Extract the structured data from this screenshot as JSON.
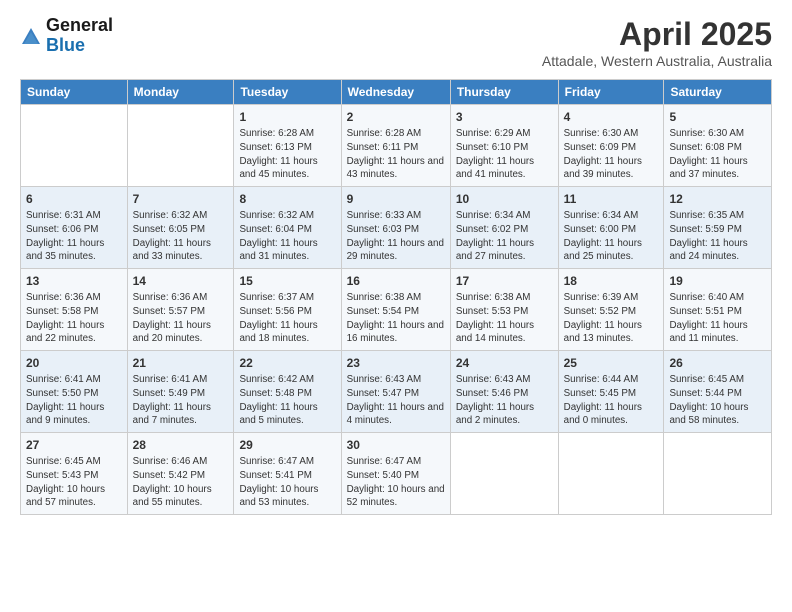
{
  "header": {
    "logo_line1": "General",
    "logo_line2": "Blue",
    "month_title": "April 2025",
    "location": "Attadale, Western Australia, Australia"
  },
  "weekdays": [
    "Sunday",
    "Monday",
    "Tuesday",
    "Wednesday",
    "Thursday",
    "Friday",
    "Saturday"
  ],
  "weeks": [
    [
      {
        "day": "",
        "sunrise": "",
        "sunset": "",
        "daylight": ""
      },
      {
        "day": "",
        "sunrise": "",
        "sunset": "",
        "daylight": ""
      },
      {
        "day": "1",
        "sunrise": "Sunrise: 6:28 AM",
        "sunset": "Sunset: 6:13 PM",
        "daylight": "Daylight: 11 hours and 45 minutes."
      },
      {
        "day": "2",
        "sunrise": "Sunrise: 6:28 AM",
        "sunset": "Sunset: 6:11 PM",
        "daylight": "Daylight: 11 hours and 43 minutes."
      },
      {
        "day": "3",
        "sunrise": "Sunrise: 6:29 AM",
        "sunset": "Sunset: 6:10 PM",
        "daylight": "Daylight: 11 hours and 41 minutes."
      },
      {
        "day": "4",
        "sunrise": "Sunrise: 6:30 AM",
        "sunset": "Sunset: 6:09 PM",
        "daylight": "Daylight: 11 hours and 39 minutes."
      },
      {
        "day": "5",
        "sunrise": "Sunrise: 6:30 AM",
        "sunset": "Sunset: 6:08 PM",
        "daylight": "Daylight: 11 hours and 37 minutes."
      }
    ],
    [
      {
        "day": "6",
        "sunrise": "Sunrise: 6:31 AM",
        "sunset": "Sunset: 6:06 PM",
        "daylight": "Daylight: 11 hours and 35 minutes."
      },
      {
        "day": "7",
        "sunrise": "Sunrise: 6:32 AM",
        "sunset": "Sunset: 6:05 PM",
        "daylight": "Daylight: 11 hours and 33 minutes."
      },
      {
        "day": "8",
        "sunrise": "Sunrise: 6:32 AM",
        "sunset": "Sunset: 6:04 PM",
        "daylight": "Daylight: 11 hours and 31 minutes."
      },
      {
        "day": "9",
        "sunrise": "Sunrise: 6:33 AM",
        "sunset": "Sunset: 6:03 PM",
        "daylight": "Daylight: 11 hours and 29 minutes."
      },
      {
        "day": "10",
        "sunrise": "Sunrise: 6:34 AM",
        "sunset": "Sunset: 6:02 PM",
        "daylight": "Daylight: 11 hours and 27 minutes."
      },
      {
        "day": "11",
        "sunrise": "Sunrise: 6:34 AM",
        "sunset": "Sunset: 6:00 PM",
        "daylight": "Daylight: 11 hours and 25 minutes."
      },
      {
        "day": "12",
        "sunrise": "Sunrise: 6:35 AM",
        "sunset": "Sunset: 5:59 PM",
        "daylight": "Daylight: 11 hours and 24 minutes."
      }
    ],
    [
      {
        "day": "13",
        "sunrise": "Sunrise: 6:36 AM",
        "sunset": "Sunset: 5:58 PM",
        "daylight": "Daylight: 11 hours and 22 minutes."
      },
      {
        "day": "14",
        "sunrise": "Sunrise: 6:36 AM",
        "sunset": "Sunset: 5:57 PM",
        "daylight": "Daylight: 11 hours and 20 minutes."
      },
      {
        "day": "15",
        "sunrise": "Sunrise: 6:37 AM",
        "sunset": "Sunset: 5:56 PM",
        "daylight": "Daylight: 11 hours and 18 minutes."
      },
      {
        "day": "16",
        "sunrise": "Sunrise: 6:38 AM",
        "sunset": "Sunset: 5:54 PM",
        "daylight": "Daylight: 11 hours and 16 minutes."
      },
      {
        "day": "17",
        "sunrise": "Sunrise: 6:38 AM",
        "sunset": "Sunset: 5:53 PM",
        "daylight": "Daylight: 11 hours and 14 minutes."
      },
      {
        "day": "18",
        "sunrise": "Sunrise: 6:39 AM",
        "sunset": "Sunset: 5:52 PM",
        "daylight": "Daylight: 11 hours and 13 minutes."
      },
      {
        "day": "19",
        "sunrise": "Sunrise: 6:40 AM",
        "sunset": "Sunset: 5:51 PM",
        "daylight": "Daylight: 11 hours and 11 minutes."
      }
    ],
    [
      {
        "day": "20",
        "sunrise": "Sunrise: 6:41 AM",
        "sunset": "Sunset: 5:50 PM",
        "daylight": "Daylight: 11 hours and 9 minutes."
      },
      {
        "day": "21",
        "sunrise": "Sunrise: 6:41 AM",
        "sunset": "Sunset: 5:49 PM",
        "daylight": "Daylight: 11 hours and 7 minutes."
      },
      {
        "day": "22",
        "sunrise": "Sunrise: 6:42 AM",
        "sunset": "Sunset: 5:48 PM",
        "daylight": "Daylight: 11 hours and 5 minutes."
      },
      {
        "day": "23",
        "sunrise": "Sunrise: 6:43 AM",
        "sunset": "Sunset: 5:47 PM",
        "daylight": "Daylight: 11 hours and 4 minutes."
      },
      {
        "day": "24",
        "sunrise": "Sunrise: 6:43 AM",
        "sunset": "Sunset: 5:46 PM",
        "daylight": "Daylight: 11 hours and 2 minutes."
      },
      {
        "day": "25",
        "sunrise": "Sunrise: 6:44 AM",
        "sunset": "Sunset: 5:45 PM",
        "daylight": "Daylight: 11 hours and 0 minutes."
      },
      {
        "day": "26",
        "sunrise": "Sunrise: 6:45 AM",
        "sunset": "Sunset: 5:44 PM",
        "daylight": "Daylight: 10 hours and 58 minutes."
      }
    ],
    [
      {
        "day": "27",
        "sunrise": "Sunrise: 6:45 AM",
        "sunset": "Sunset: 5:43 PM",
        "daylight": "Daylight: 10 hours and 57 minutes."
      },
      {
        "day": "28",
        "sunrise": "Sunrise: 6:46 AM",
        "sunset": "Sunset: 5:42 PM",
        "daylight": "Daylight: 10 hours and 55 minutes."
      },
      {
        "day": "29",
        "sunrise": "Sunrise: 6:47 AM",
        "sunset": "Sunset: 5:41 PM",
        "daylight": "Daylight: 10 hours and 53 minutes."
      },
      {
        "day": "30",
        "sunrise": "Sunrise: 6:47 AM",
        "sunset": "Sunset: 5:40 PM",
        "daylight": "Daylight: 10 hours and 52 minutes."
      },
      {
        "day": "",
        "sunrise": "",
        "sunset": "",
        "daylight": ""
      },
      {
        "day": "",
        "sunrise": "",
        "sunset": "",
        "daylight": ""
      },
      {
        "day": "",
        "sunrise": "",
        "sunset": "",
        "daylight": ""
      }
    ]
  ]
}
